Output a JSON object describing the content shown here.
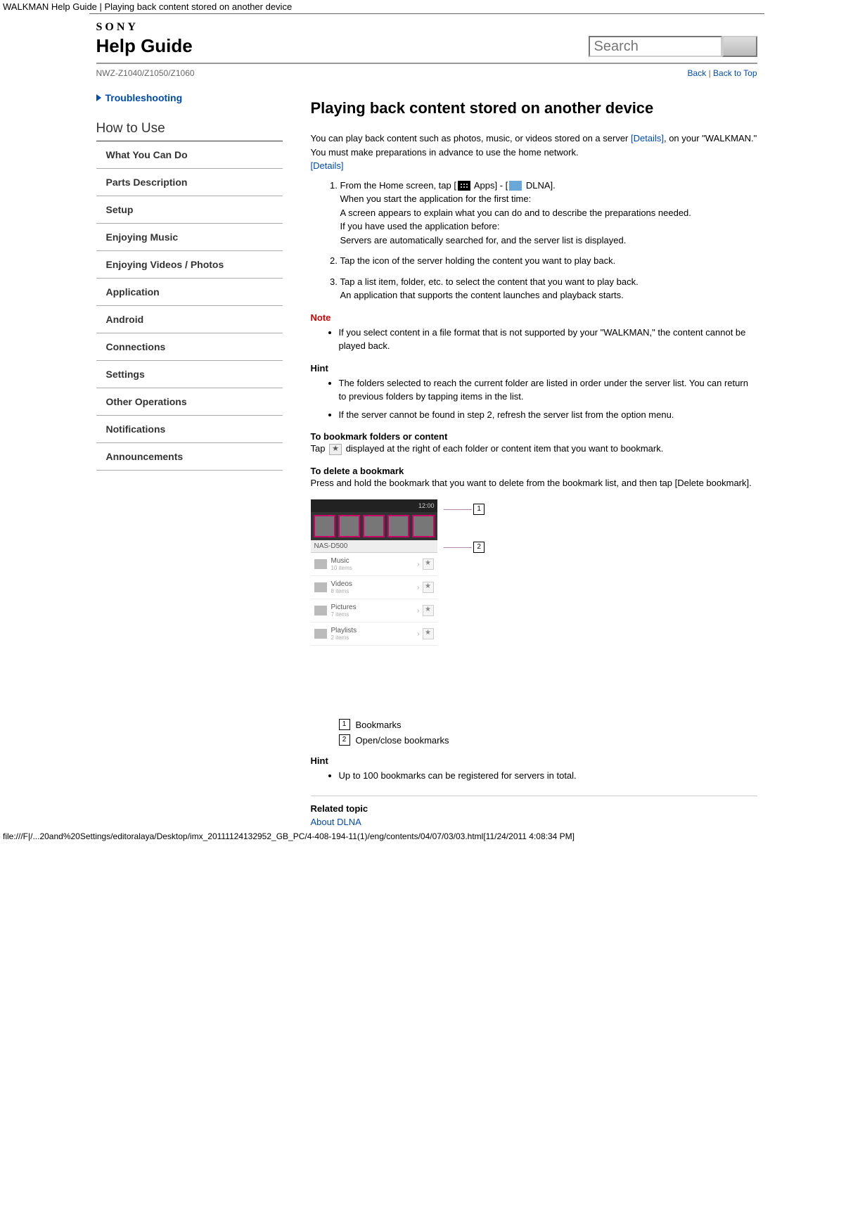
{
  "page_header_path": "WALKMAN Help Guide | Playing back content stored on another device",
  "brand": "SONY",
  "title": "Help Guide",
  "search_placeholder": "Search",
  "model": "NWZ-Z1040/Z1050/Z1060",
  "back_link": "Back",
  "back_to_top_link": "Back to Top",
  "sidebar": {
    "troubleshooting": "Troubleshooting",
    "how_to_use": "How to Use",
    "items": [
      "What You Can Do",
      "Parts Description",
      "Setup",
      "Enjoying Music",
      "Enjoying Videos / Photos",
      "Application",
      "Android",
      "Connections",
      "Settings",
      "Other Operations",
      "Notifications",
      "Announcements"
    ]
  },
  "article": {
    "heading": "Playing back content stored on another device",
    "intro_a": "You can play back content such as photos, music, or videos stored on a server ",
    "details1": "[Details]",
    "intro_b": ", on your \"WALKMAN.\" You must make preparations in advance to use the home network. ",
    "details2": "[Details]",
    "step1_a": "From the Home screen, tap [",
    "step1_apps": " Apps] - [",
    "step1_dlna": " DLNA].",
    "step1_line2": "When you start the application for the first time:",
    "step1_line3": "A screen appears to explain what you can do and to describe the preparations needed.",
    "step1_line4": "If you have used the application before:",
    "step1_line5": "Servers are automatically searched for, and the server list is displayed.",
    "step2": "Tap the icon of the server holding the content you want to play back.",
    "step3_a": "Tap a list item, folder, etc. to select the content that you want to play back.",
    "step3_b": "An application that supports the content launches and playback starts.",
    "note_label": "Note",
    "note1": "If you select content in a file format that is not supported by your \"WALKMAN,\" the content cannot be played back.",
    "hint_label": "Hint",
    "hint1": "The folders selected to reach the current folder are listed in order under the server list. You can return to previous folders by tapping items in the list.",
    "hint2": "If the server cannot be found in step 2, refresh the server list from the option menu.",
    "bookmark_heading": "To bookmark folders or content",
    "bookmark_text_a": "Tap ",
    "bookmark_text_b": " displayed at the right of each folder or content item that you want to bookmark.",
    "delete_heading": "To delete a bookmark",
    "delete_text": "Press and hold the bookmark that you want to delete from the bookmark list, and then tap [Delete bookmark].",
    "mock": {
      "time": "12:00",
      "server": "NAS-D500",
      "rows": [
        {
          "name": "Music",
          "sub": "10 items"
        },
        {
          "name": "Videos",
          "sub": "8 items"
        },
        {
          "name": "Pictures",
          "sub": "7 items"
        },
        {
          "name": "Playlists",
          "sub": "2 items"
        }
      ]
    },
    "callout1": "1",
    "callout2": "2",
    "legend1": "Bookmarks",
    "legend2": "Open/close bookmarks",
    "hint2_label": "Hint",
    "hint3": "Up to 100 bookmarks can be registered for servers in total.",
    "related_label": "Related topic",
    "related_link": "About DLNA"
  },
  "footer_path": "file:///F|/...20and%20Settings/editoralaya/Desktop/imx_20111124132952_GB_PC/4-408-194-11(1)/eng/contents/04/07/03/03.html[11/24/2011 4:08:34 PM]"
}
